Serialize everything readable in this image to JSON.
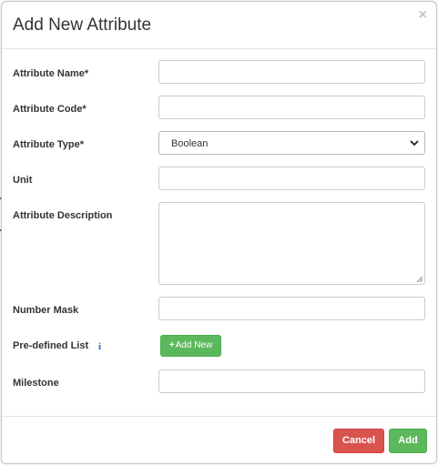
{
  "modal": {
    "title": "Add New Attribute",
    "close_symbol": "×"
  },
  "form": {
    "attribute_name": {
      "label": "Attribute Name*",
      "value": ""
    },
    "attribute_code": {
      "label": "Attribute Code*",
      "value": ""
    },
    "attribute_type": {
      "label": "Attribute Type*",
      "selected": "Boolean"
    },
    "unit": {
      "label": "Unit",
      "value": ""
    },
    "attribute_description": {
      "label": "Attribute Description",
      "value": ""
    },
    "number_mask": {
      "label": "Number Mask",
      "value": ""
    },
    "predefined_list": {
      "label": "Pre-defined List",
      "info_icon": "info-icon",
      "add_new_label": "Add New",
      "add_new_icon": "plus-icon"
    },
    "milestone": {
      "label": "Milestone",
      "value": ""
    }
  },
  "footer": {
    "cancel_label": "Cancel",
    "add_label": "Add"
  },
  "colors": {
    "success": "#5cb85c",
    "danger": "#d9534f",
    "info": "#2a62d4"
  }
}
